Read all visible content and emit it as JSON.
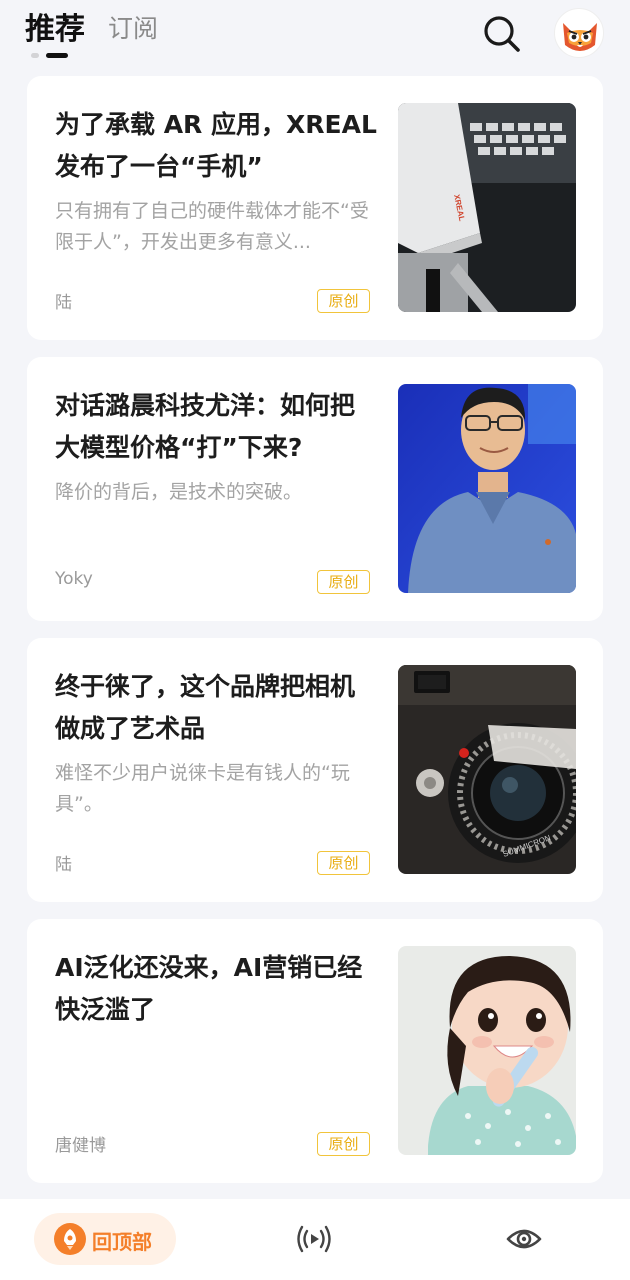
{
  "header": {
    "tabs": [
      {
        "label": "推荐",
        "active": true
      },
      {
        "label": "订阅",
        "active": false
      }
    ],
    "search_icon": "search-icon",
    "avatar_icon": "owl-avatar-icon"
  },
  "articles": [
    {
      "title": "为了承载 AR 应用，XREAL 发布了一台“手机”",
      "summary": "只有拥有了自己的硬件载体才能不“受限于人”，开发出更多有意义...",
      "author": "陆",
      "badge": "原创",
      "thumb_brand": "XREAL"
    },
    {
      "title": "对话潞晨科技尤洋：如何把大模型价格“打”下来?",
      "summary": "降价的背后，是技术的突破。",
      "author": "Yoky",
      "badge": "原创"
    },
    {
      "title": "终于徕了，这个品牌把相机做成了艺术品",
      "summary": "难怪不少用户说徕卡是有钱人的“玩具”。",
      "author": "陆",
      "badge": "原创",
      "thumb_lens_text": "SUMMICRON"
    },
    {
      "title": "AI泛化还没来，AI营销已经快泛滥了",
      "summary": "",
      "author": "唐健博",
      "badge": "原创"
    }
  ],
  "bottom_nav": {
    "back_to_top_label": "回顶部",
    "back_to_top_icon": "rocket-icon",
    "live_icon": "broadcast-icon",
    "eye_icon": "eye-icon"
  },
  "colors": {
    "accent_orange": "#f47f2a",
    "badge_yellow": "#e9ae14",
    "background": "#f4f5f9"
  }
}
